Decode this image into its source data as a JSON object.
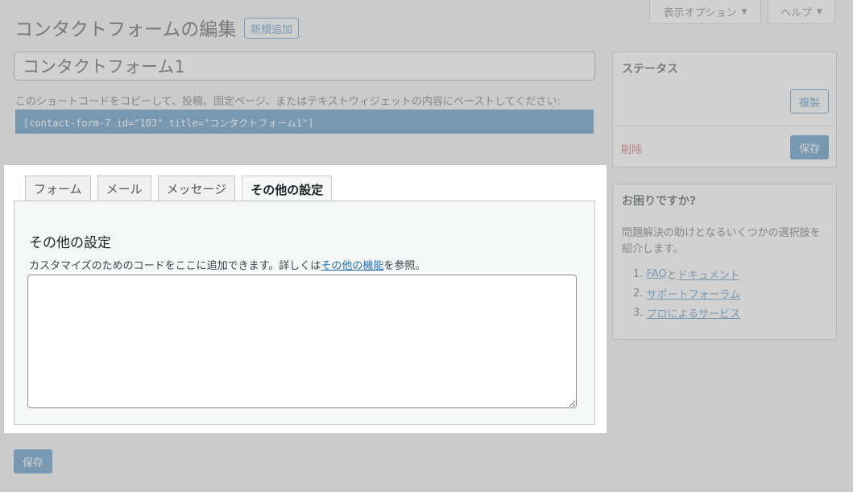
{
  "header": {
    "title": "コンタクトフォームの編集",
    "add_new_label": "新規追加",
    "screen_options_label": "表示オプション",
    "help_label": "ヘルプ"
  },
  "form": {
    "title_value": "コンタクトフォーム1",
    "shortcode_description": "このショートコードをコピーして、投稿、固定ページ、またはテキストウィジェットの内容にペーストしてください:",
    "shortcode": "[contact-form-7 id=\"103\" title=\"コンタクトフォーム1\"]"
  },
  "tabs": [
    {
      "label": "フォーム"
    },
    {
      "label": "メール"
    },
    {
      "label": "メッセージ"
    },
    {
      "label": "その他の設定"
    }
  ],
  "panel": {
    "heading": "その他の設定",
    "description_prefix": "カスタマイズのためのコードをここに追加できます。詳しくは",
    "description_link": "その他の機能",
    "description_suffix": "を参照。",
    "textarea_value": ""
  },
  "status_box": {
    "title": "ステータス",
    "duplicate_label": "複製",
    "delete_label": "削除",
    "save_label": "保存"
  },
  "help_box": {
    "title": "お困りですか?",
    "description_line1": "問題解決の助けとなるいくつかの選択肢を",
    "description_line2": "紹介します。",
    "items": [
      {
        "number": "1.",
        "link1": "FAQ",
        "connector": "と",
        "link2": "ドキュメント"
      },
      {
        "number": "2.",
        "link1": "サポートフォーラム"
      },
      {
        "number": "3.",
        "link1": "プロによるサービス"
      }
    ]
  },
  "bottom_save_label": "保存",
  "colors": {
    "accent": "#2271b1",
    "delete": "#b32d2e",
    "background": "#f0f0f1"
  }
}
